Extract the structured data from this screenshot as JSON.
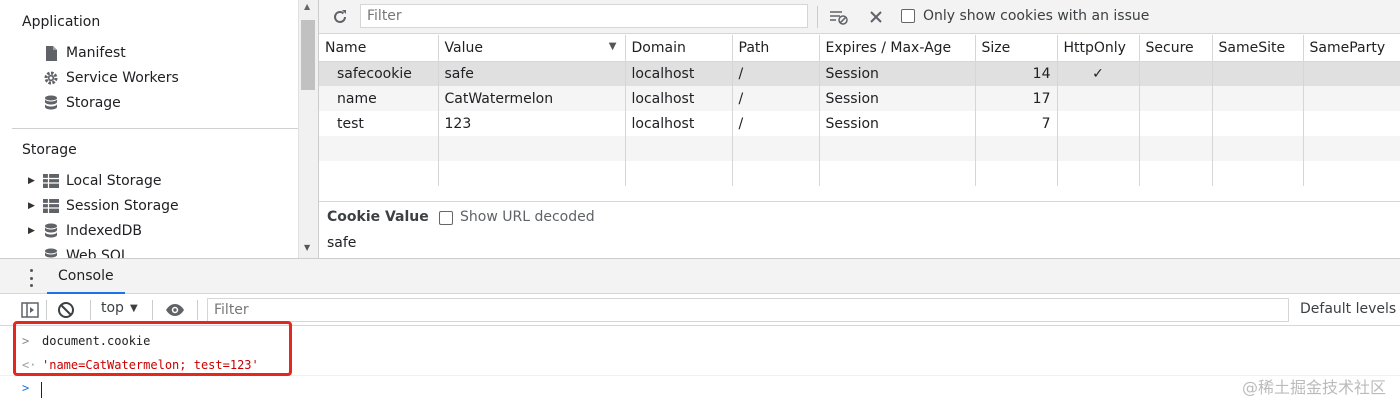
{
  "sidebar": {
    "application_title": "Application",
    "application_items": [
      {
        "label": "Manifest",
        "icon": "document-icon"
      },
      {
        "label": "Service Workers",
        "icon": "gear-icon"
      },
      {
        "label": "Storage",
        "icon": "database-icon"
      }
    ],
    "storage_title": "Storage",
    "storage_items": [
      {
        "label": "Local Storage",
        "icon": "table-icon"
      },
      {
        "label": "Session Storage",
        "icon": "table-icon"
      },
      {
        "label": "IndexedDB",
        "icon": "database-icon"
      },
      {
        "label": "Web SQL",
        "icon": "database-icon"
      }
    ]
  },
  "toolbar": {
    "refresh_icon": "refresh-icon",
    "filter_placeholder": "Filter",
    "clear_filter_icon": "clear-filter-icon",
    "delete_icon": "close-icon",
    "only_issues_label": "Only show cookies with an issue"
  },
  "cookies": {
    "columns": [
      "Name",
      "Value",
      "Domain",
      "Path",
      "Expires / Max-Age",
      "Size",
      "HttpOnly",
      "Secure",
      "SameSite",
      "SameParty"
    ],
    "sorted_column": "Value",
    "rows": [
      {
        "name": "safecookie",
        "value": "safe",
        "domain": "localhost",
        "path": "/",
        "expires": "Session",
        "size": "14",
        "httponly": "✓",
        "secure": "",
        "samesite": "",
        "sameparty": "",
        "selected": true
      },
      {
        "name": "name",
        "value": "CatWatermelon",
        "domain": "localhost",
        "path": "/",
        "expires": "Session",
        "size": "17",
        "httponly": "",
        "secure": "",
        "samesite": "",
        "sameparty": "",
        "selected": false
      },
      {
        "name": "test",
        "value": "123",
        "domain": "localhost",
        "path": "/",
        "expires": "Session",
        "size": "7",
        "httponly": "",
        "secure": "",
        "samesite": "",
        "sameparty": "",
        "selected": false
      }
    ]
  },
  "cookie_value": {
    "title": "Cookie Value",
    "show_decoded_label": "Show URL decoded",
    "value": "safe"
  },
  "drawer": {
    "tab_label": "Console"
  },
  "console_toolbar": {
    "context": "top",
    "filter_placeholder": "Filter",
    "levels": "Default levels"
  },
  "console": {
    "input": "document.cookie",
    "output": "'name=CatWatermelon; test=123'",
    "input_prefix": ">",
    "output_prefix": "<·",
    "prompt_prefix": ">"
  },
  "watermark": "@稀土掘金技术社区",
  "colors": {
    "accent": "#1a73e8",
    "highlight_border": "#e5281f",
    "console_string": "#c80000"
  }
}
